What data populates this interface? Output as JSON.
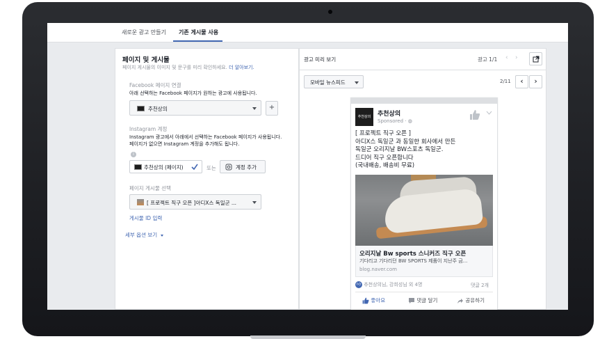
{
  "tabs": [
    {
      "label": "새로운 광고 만들기"
    },
    {
      "label": "기존 게시물 사용"
    }
  ],
  "left": {
    "title": "페이지 및 게시물",
    "subtitle": "페이지 게시물의 이미지 및 문구를 미리 확인하세요.",
    "learn_more": "더 알아보기.",
    "facebook": {
      "label": "Facebook 페이지 연결",
      "desc": "아래 선택하는 Facebook 페이지가 원하는 광고에 사용됩니다.",
      "page_name": "추천상의",
      "add_symbol": "+"
    },
    "instagram": {
      "label": "Instagram 계정",
      "desc": "Instagram 광고에서 아래에서 선택하는 Facebook 페이지가 사용됩니다. 페이지가 없으면 Instagram 계정을 추가해도 됩니다.",
      "selected": "추천상의 (페이지)",
      "or": "또는",
      "add_account": "계정 추가"
    },
    "post": {
      "label": "페이지 게시물 선택",
      "selected": "[ 프로젝트 직구 오픈 ]아디X스 독일군 ..."
    },
    "post_id_link": "게시물 ID 입력",
    "more_options": "세부 옵션 보기"
  },
  "preview": {
    "title": "광고 미리 보기",
    "count": "광고 1/1",
    "placement": "모바일 뉴스피드",
    "page_counter": "2/11",
    "post": {
      "page_name": "추천상의",
      "logo_text": "추천상의",
      "sponsored": "Sponsored",
      "text_lines": [
        "[ 프로젝트 직구 오픈 ]",
        "아디X스 독일군 과 동일한 회사에서 만든",
        "독일군 오리지날 BW스포츠 독일군.",
        "드디어 직구 오픈합니다",
        "(국내배송, 배송비 무료)"
      ],
      "link_title": "오리지날 Bw sports 스니커즈 직구 오픈",
      "link_desc": "기다리고 기다리던 BW SPORTS 제품이 지난주 금...",
      "link_domain": "blog.naver.com",
      "reactions": "추천상의님, 강희성님 외 4명",
      "comments": "댓글 2개",
      "like": "좋아요",
      "comment": "댓글 달기",
      "share": "공유하기"
    }
  },
  "colors": {
    "accent": "#4267b2",
    "bg": "#e9ebee"
  }
}
